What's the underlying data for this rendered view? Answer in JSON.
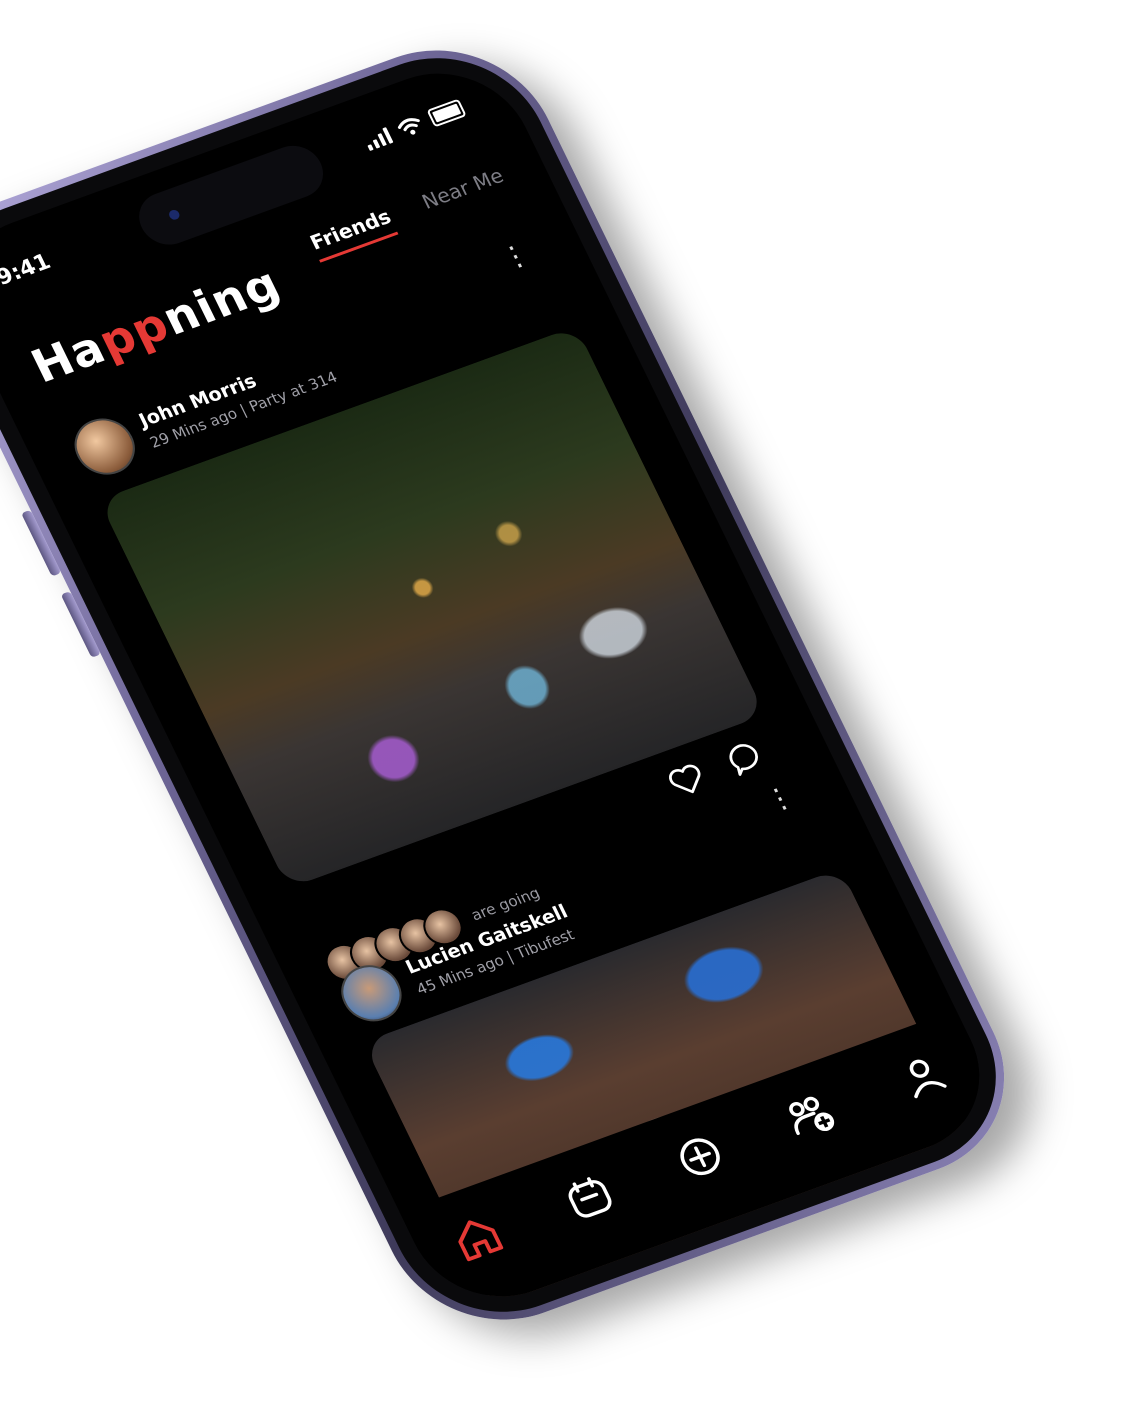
{
  "status": {
    "time": "9:41"
  },
  "app": {
    "logo_prefix": "Ha",
    "logo_accent": "pp",
    "logo_suffix": "ning"
  },
  "tabs": {
    "friends": "Friends",
    "near_me": "Near Me"
  },
  "posts": [
    {
      "author": "John Morris",
      "meta": "29 Mins ago | Party at 314"
    },
    {
      "author": "Lucien Gaitskell",
      "meta": "45 Mins ago | Tibufest"
    }
  ],
  "going": {
    "text": "are going"
  },
  "colors": {
    "accent": "#e53935",
    "background": "#000000",
    "frame": "#7a72a6"
  },
  "nav": {
    "items": [
      "home-icon",
      "calendar-icon",
      "add-icon",
      "add-friend-icon",
      "profile-icon"
    ],
    "active": "home-icon"
  }
}
